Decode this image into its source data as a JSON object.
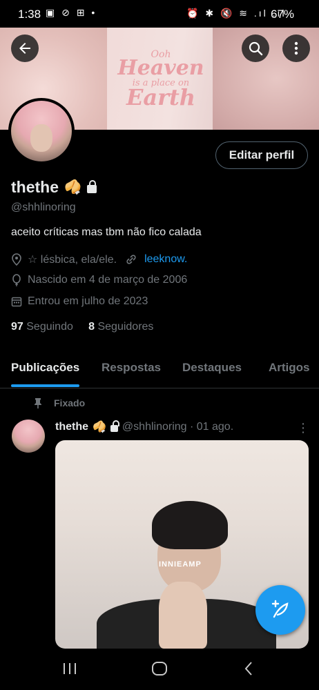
{
  "status_bar": {
    "time": "1:38",
    "left_icons": "▣ ⊘ ⊞ •",
    "right_icons": "⏰ ✱ 🔇 ≋ .ıl .ıl",
    "battery": "67%"
  },
  "banner": {
    "ooh": "Ooh",
    "heaven": "Heaven",
    "sub": "is a place on",
    "earth": "Earth"
  },
  "header": {
    "edit_profile": "Editar perfil"
  },
  "profile": {
    "display_name": "thethe",
    "name_emoji": "🥠",
    "handle": "@shhlinoring",
    "bio": "aceito críticas mas tbm não fico calada",
    "location": "☆ lésbica, ela/ele.",
    "link": "leeknow.",
    "birth": "Nascido em 4 de março de 2006",
    "joined": "Entrou em julho de 2023",
    "following_count": "97",
    "following_label": "Seguindo",
    "followers_count": "8",
    "followers_label": "Seguidores"
  },
  "tabs": [
    {
      "label": "Publicações",
      "active": true
    },
    {
      "label": "Respostas",
      "active": false
    },
    {
      "label": "Destaques",
      "active": false
    },
    {
      "label": "Artigos",
      "active": false
    }
  ],
  "pinned_post": {
    "pinned_label": "Fixado",
    "name": "thethe",
    "emoji": "🥠",
    "handle_time": "@shhlinoring · 01 ago.",
    "more": "⋮",
    "media_watermark": "INNIEAMP"
  },
  "colors": {
    "accent": "#1d9bf0",
    "background": "#000000",
    "text": "#e7e9ea",
    "muted": "#71767b"
  }
}
